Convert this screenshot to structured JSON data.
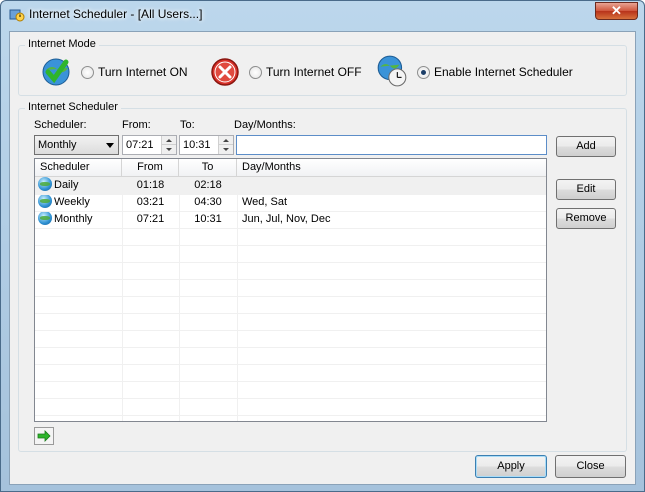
{
  "window": {
    "title": "Internet Scheduler - [All Users...]",
    "close_label": "✕"
  },
  "internet_mode": {
    "group_title": "Internet Mode",
    "options": [
      {
        "label": "Turn Internet ON",
        "icon": "globe-check-icon",
        "selected": false
      },
      {
        "label": "Turn Internet OFF",
        "icon": "red-x-icon",
        "selected": false
      },
      {
        "label": "Enable Internet Scheduler",
        "icon": "globe-clock-icon",
        "selected": true
      }
    ]
  },
  "scheduler": {
    "group_title": "Internet Scheduler",
    "labels": {
      "scheduler": "Scheduler:",
      "from": "From:",
      "to": "To:",
      "days": "Day/Months:"
    },
    "combo_value": "Monthly",
    "from_value": "07:21",
    "to_value": "10:31",
    "days_value": "",
    "buttons": {
      "add": "Add",
      "edit": "Edit",
      "remove": "Remove"
    },
    "columns": [
      "Scheduler",
      "From",
      "To",
      "Day/Months"
    ],
    "rows": [
      {
        "scheduler": "Daily",
        "from": "01:18",
        "to": "02:18",
        "days": ""
      },
      {
        "scheduler": "Weekly",
        "from": "03:21",
        "to": "04:30",
        "days": "Wed, Sat"
      },
      {
        "scheduler": "Monthly",
        "from": "07:21",
        "to": "10:31",
        "days": "Jun, Jul, Nov, Dec"
      }
    ]
  },
  "footer": {
    "apply": "Apply",
    "close": "Close"
  },
  "colors": {
    "titlebar": "#bcd7ec",
    "close_button": "#c8452a",
    "client_bg": "#f0f0f0",
    "selected_row": "#f0f0f0"
  }
}
